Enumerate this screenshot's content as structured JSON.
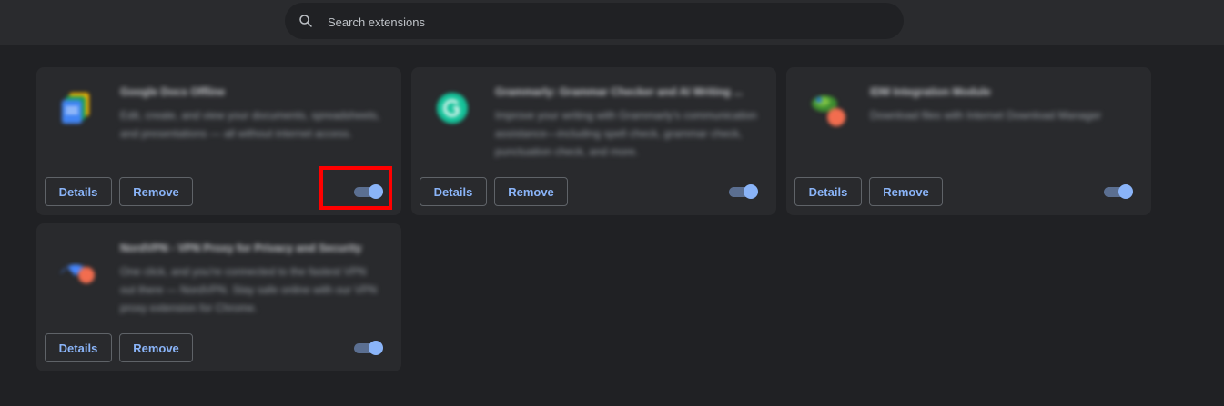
{
  "search": {
    "placeholder": "Search extensions",
    "icon": "search-icon"
  },
  "buttons": {
    "details_label": "Details",
    "remove_label": "Remove"
  },
  "extensions": [
    {
      "name": "Google Docs Offline",
      "description": "Edit, create, and view your documents, spreadsheets, and presentations — all without internet access.",
      "icon": "google-docs-offline-icon",
      "enabled": true
    },
    {
      "name": "Grammarly: Grammar Checker and AI Writing ...",
      "description": "Improve your writing with Grammarly's communication assistance—including spell check, grammar check, punctuation check, and more.",
      "icon": "grammarly-icon",
      "enabled": true
    },
    {
      "name": "IDM Integration Module",
      "description": "Download files with Internet Download Manager",
      "icon": "idm-icon",
      "enabled": true
    },
    {
      "name": "NordVPN - VPN Proxy for Privacy and Security",
      "description": "One click, and you're connected to the fastest VPN out there — NordVPN. Stay safe online with our VPN proxy extension for Chrome.",
      "icon": "nordvpn-icon",
      "enabled": true
    }
  ],
  "colors": {
    "background": "#202124",
    "card": "#292a2d",
    "accent": "#8ab4f8",
    "highlight": "#ff0000"
  }
}
